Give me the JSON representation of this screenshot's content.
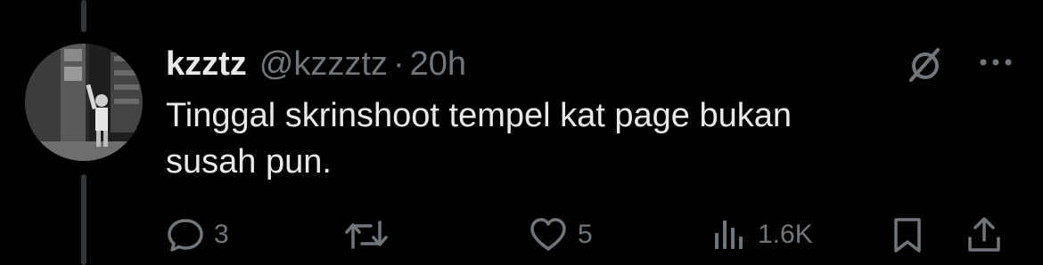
{
  "tweet": {
    "display_name": "kzztz",
    "handle": "@kzzztz",
    "separator": "·",
    "time": "20h",
    "text_line1": "Tinggal skrinshoot tempel kat page bukan",
    "text_line2": "susah pun."
  },
  "actions": {
    "reply": {
      "icon": "reply-icon",
      "count": "3"
    },
    "repost": {
      "icon": "repost-icon",
      "count": ""
    },
    "like": {
      "icon": "heart-icon",
      "count": "5"
    },
    "views": {
      "icon": "views-icon",
      "count": "1.6K"
    },
    "bookmark": {
      "icon": "bookmark-icon"
    },
    "share": {
      "icon": "share-icon"
    }
  },
  "colors": {
    "background": "#000000",
    "primary_text": "#e7e9ea",
    "secondary_text": "#71767b",
    "thread_line": "#333639"
  }
}
